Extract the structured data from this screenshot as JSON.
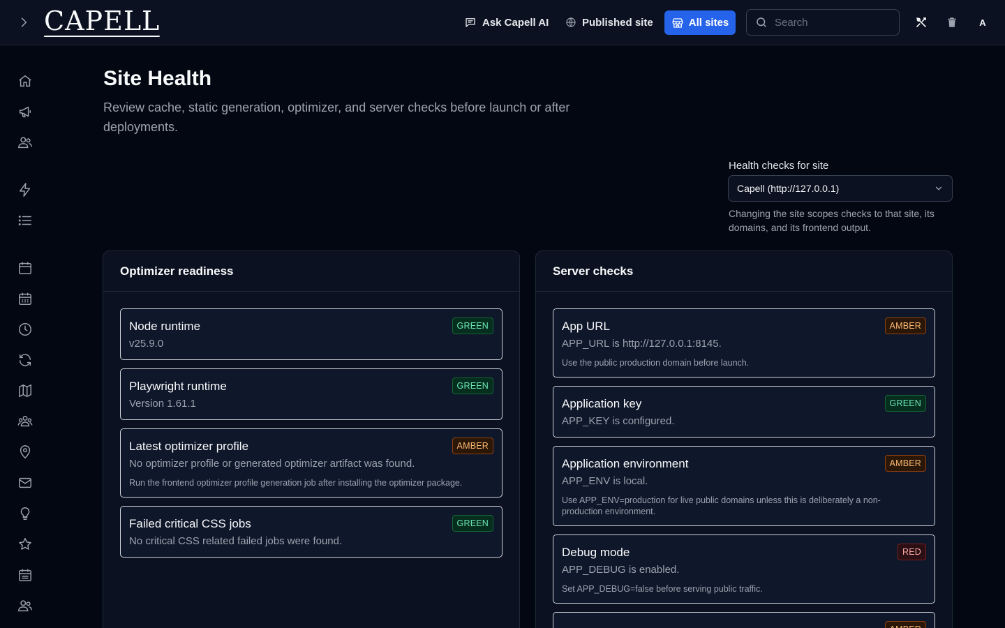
{
  "header": {
    "logo": "CAPELL",
    "ask_ai": "Ask Capell AI",
    "published_site": "Published site",
    "all_sites": "All sites",
    "search_placeholder": "Search",
    "avatar_initial": "A"
  },
  "sidebar": {
    "icons": [
      "home-icon",
      "megaphone-icon",
      "users-icon",
      "bolt-icon",
      "list-icon",
      "calendar-icon",
      "calendar-grid-icon",
      "clock-icon",
      "refresh-icon",
      "map-icon",
      "user-group-icon",
      "map-pin-icon",
      "mail-icon",
      "lightbulb-icon",
      "star-icon",
      "calendar-days-icon",
      "team-icon"
    ]
  },
  "page": {
    "title": "Site Health",
    "description": "Review cache, static generation, optimizer, and server checks before launch or after deployments."
  },
  "site_selector": {
    "label": "Health checks for site",
    "value": "Capell (http://127.0.0.1)",
    "help": "Changing the site scopes checks to that site, its domains, and its frontend output."
  },
  "optimizer": {
    "title": "Optimizer readiness",
    "checks": [
      {
        "title": "Node runtime",
        "detail": "v25.9.0",
        "advice": "",
        "status": "GREEN"
      },
      {
        "title": "Playwright runtime",
        "detail": "Version 1.61.1",
        "advice": "",
        "status": "GREEN"
      },
      {
        "title": "Latest optimizer profile",
        "detail": "No optimizer profile or generated optimizer artifact was found.",
        "advice": "Run the frontend optimizer profile generation job after installing the optimizer package.",
        "status": "AMBER"
      },
      {
        "title": "Failed critical CSS jobs",
        "detail": "No critical CSS related failed jobs were found.",
        "advice": "",
        "status": "GREEN"
      }
    ]
  },
  "server": {
    "title": "Server checks",
    "checks": [
      {
        "title": "App URL",
        "detail": "APP_URL is http://127.0.0.1:8145.",
        "advice": "Use the public production domain before launch.",
        "status": "AMBER"
      },
      {
        "title": "Application key",
        "detail": "APP_KEY is configured.",
        "advice": "",
        "status": "GREEN"
      },
      {
        "title": "Application environment",
        "detail": "APP_ENV is local.",
        "advice": "Use APP_ENV=production for live public domains unless this is deliberately a non-production environment.",
        "status": "AMBER"
      },
      {
        "title": "Debug mode",
        "detail": "APP_DEBUG is enabled.",
        "advice": "Set APP_DEBUG=false before serving public traffic.",
        "status": "RED"
      },
      {
        "title": "",
        "detail": "",
        "advice": "",
        "status": "AMBER"
      }
    ]
  },
  "colors": {
    "accent": "#2563eb",
    "green": "#6ee7b7",
    "amber": "#fdba74",
    "red": "#fca5a5"
  }
}
